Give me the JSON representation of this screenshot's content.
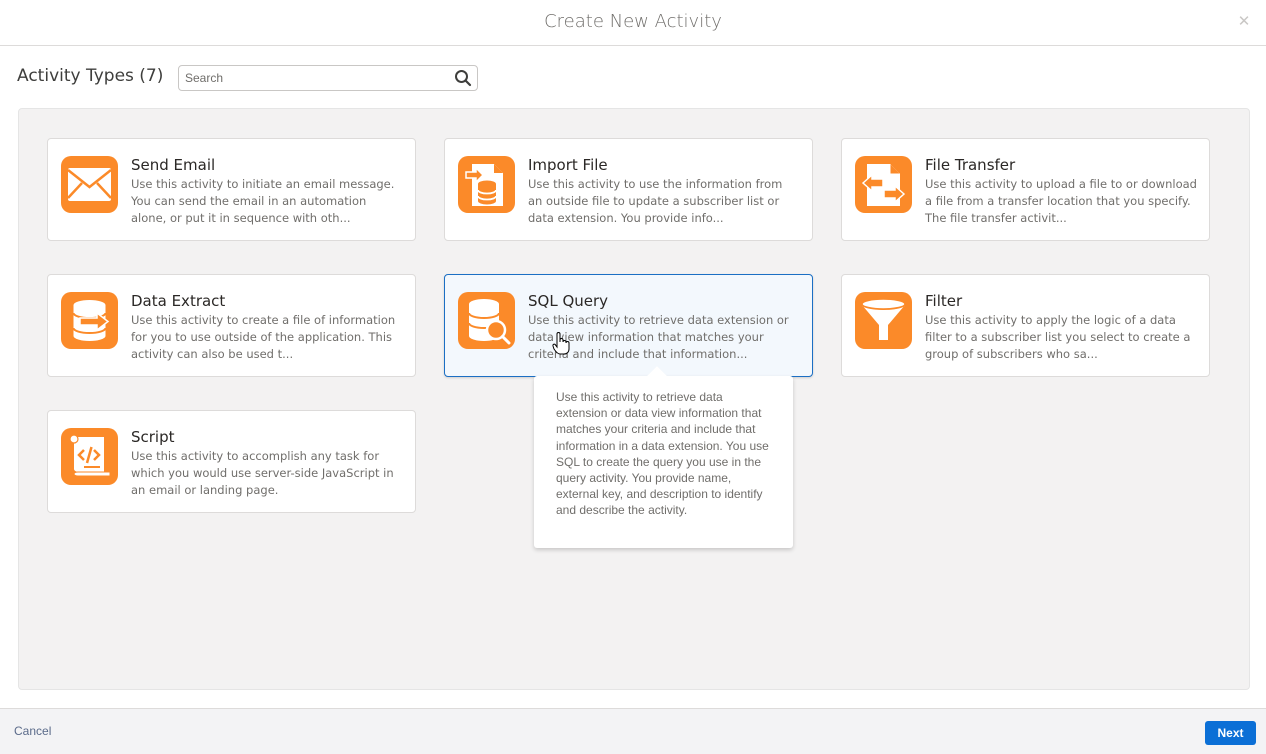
{
  "dialog": {
    "title": "Create New Activity",
    "close_icon": "close-icon"
  },
  "toolbar": {
    "heading": "Activity Types (7)",
    "search": {
      "value": "",
      "placeholder": "Search",
      "icon": "search-icon"
    }
  },
  "activities": [
    {
      "name": "Send Email",
      "icon": "envelope-icon",
      "description": "Use this activity to initiate an email message. You can send the email in an automation alone, or put it in sequence with oth...",
      "selected": false
    },
    {
      "name": "Import File",
      "icon": "import-file-icon",
      "description": "Use this activity to use the information from an outside file to update a subscriber list or data extension. You provide info...",
      "selected": false
    },
    {
      "name": "File Transfer",
      "icon": "file-transfer-icon",
      "description": "Use this activity to upload a file to or download a file from a transfer location that you specify. The file transfer activit...",
      "selected": false
    },
    {
      "name": "Data Extract",
      "icon": "data-extract-icon",
      "description": "Use this activity to create a file of information for you to use outside of the application. This activity can also be used t...",
      "selected": false
    },
    {
      "name": "SQL Query",
      "icon": "sql-query-icon",
      "description": "Use this activity to retrieve data extension or data view information that matches your criteria and include that information...",
      "selected": true
    },
    {
      "name": "Filter",
      "icon": "filter-funnel-icon",
      "description": "Use this activity to apply the logic of a data filter to a subscriber list you select to create a group of subscribers who sa...",
      "selected": false
    },
    {
      "name": "Script",
      "icon": "script-code-icon",
      "description": "Use this activity to accomplish any task for which you would use server-side JavaScript in an email or landing page.",
      "selected": false
    }
  ],
  "tooltip": {
    "text": "Use this activity to retrieve data extension or data view information that matches your criteria and include that information in a data extension. You use SQL to create the query you use in the query activity. You provide name, external key, and description to identify and describe the activity."
  },
  "footer": {
    "cancel_label": "Cancel",
    "next_label": "Next"
  },
  "colors": {
    "accent": "#fb8a29",
    "primary_button": "#0b6fd6",
    "selected_border": "#1b6fc4"
  }
}
